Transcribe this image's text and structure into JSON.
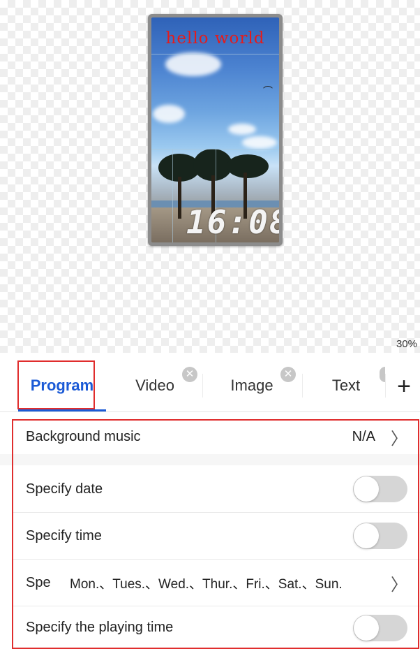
{
  "preview": {
    "overlay_text": "hello world",
    "clock_text": "16:08",
    "zoom": "30%"
  },
  "tabs": [
    {
      "label": "Program",
      "active": true
    },
    {
      "label": "Video",
      "closable": true
    },
    {
      "label": "Image",
      "closable": true
    },
    {
      "label": "Text",
      "closable": true
    }
  ],
  "add_label": "+",
  "settings": {
    "background_music": {
      "label": "Background music",
      "value": "N/A"
    },
    "specify_date": {
      "label": "Specify date",
      "enabled": false
    },
    "specify_time": {
      "label": "Specify time",
      "enabled": false
    },
    "specify_week": {
      "label": "Spe",
      "value": "Mon.、Tues.、Wed.、Thur.、Fri.、Sat.、Sun."
    },
    "specify_playing_time": {
      "label": "Specify the playing time",
      "enabled": false
    }
  },
  "colors": {
    "accent": "#1b5ad6",
    "highlight": "#e02d2d",
    "overlay_text": "#e51b1b"
  }
}
